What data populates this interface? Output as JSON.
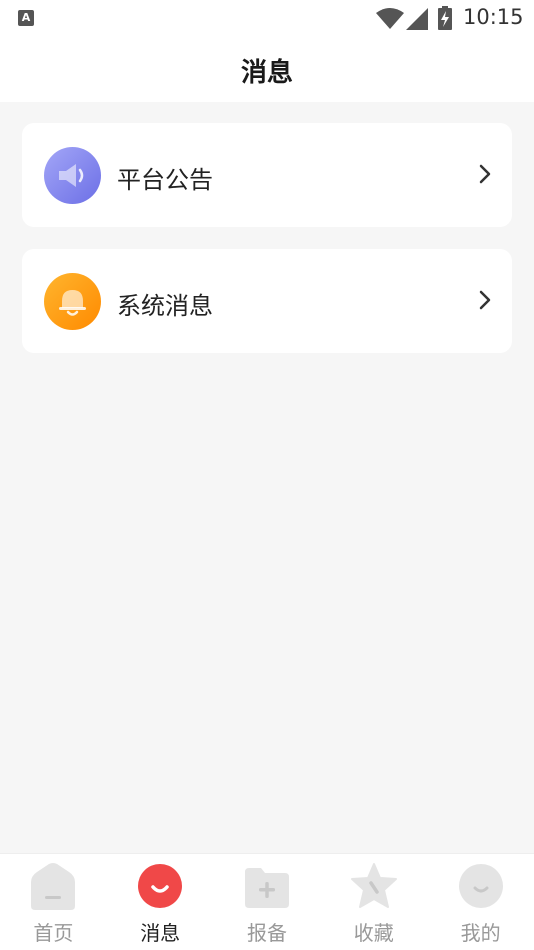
{
  "status_bar": {
    "time": "10:15",
    "app_badge": "A"
  },
  "header": {
    "title": "消息"
  },
  "cards": [
    {
      "label": "平台公告",
      "icon": "speaker-icon"
    },
    {
      "label": "系统消息",
      "icon": "bell-icon"
    }
  ],
  "tabbar": {
    "active_index": 1,
    "active_color": "#f04848",
    "items": [
      {
        "label": "首页",
        "icon": "home-icon"
      },
      {
        "label": "消息",
        "icon": "message-icon"
      },
      {
        "label": "报备",
        "icon": "folder-add-icon"
      },
      {
        "label": "收藏",
        "icon": "star-icon"
      },
      {
        "label": "我的",
        "icon": "profile-icon"
      }
    ]
  },
  "colors": {
    "background": "#f6f6f6",
    "card": "#ffffff",
    "inactive_tab": "#999999"
  }
}
